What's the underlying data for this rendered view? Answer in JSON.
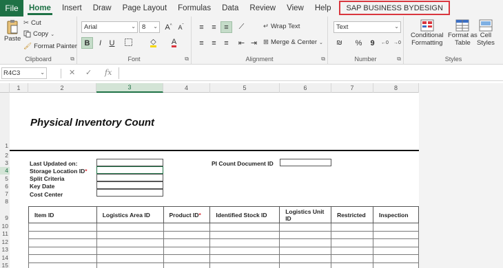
{
  "menu": {
    "file": "File",
    "tabs": [
      "Home",
      "Insert",
      "Draw",
      "Page Layout",
      "Formulas",
      "Data",
      "Review",
      "View",
      "Help"
    ],
    "active_tab": "Home",
    "sap_tab": "SAP BUSINESS BYDESIGN"
  },
  "ribbon": {
    "clipboard": {
      "paste": "Paste",
      "cut": "Cut",
      "copy": "Copy",
      "format_painter": "Format Painter",
      "label": "Clipboard"
    },
    "font": {
      "name": "Arial",
      "size": "8",
      "label": "Font",
      "bold": "B",
      "italic": "I",
      "underline": "U",
      "grow": "A^",
      "shrink": "Aˇ"
    },
    "alignment": {
      "wrap_text": "Wrap Text",
      "merge_center": "Merge & Center",
      "label": "Alignment"
    },
    "number": {
      "format": "Text",
      "label": "Number",
      "percent": "%",
      "comma": "9"
    },
    "styles": {
      "conditional": "Conditional",
      "formatting": "Formatting",
      "format_as": "Format as",
      "table": "Table",
      "cell": "Cell",
      "cell_styles": "Styles",
      "label": "Styles"
    },
    "accent_color": "#1e7145"
  },
  "formula_bar": {
    "name_box": "R4C3",
    "fx": "fx",
    "content": ""
  },
  "columns": [
    "1",
    "2",
    "3",
    "4",
    "5",
    "6",
    "7",
    "8"
  ],
  "selected_column": "3",
  "rows": [
    "1",
    "2",
    "3",
    "4",
    "5",
    "6",
    "7",
    "8",
    "9",
    "10",
    "11",
    "12",
    "13",
    "14",
    "15"
  ],
  "selected_row": "4",
  "sheet": {
    "title": "Physical Inventory Count",
    "fields": {
      "last_updated": "Last Updated on:",
      "storage_location": "Storage Location ID",
      "split_criteria": "Split Criteria",
      "key_date": "Key Date",
      "cost_center": "Cost Center",
      "pi_count_document": "PI Count Document ID",
      "required_mark": "*"
    },
    "table_headers": [
      "Item ID",
      "Logistics Area ID",
      "Product ID",
      "Identified Stock ID",
      "Logistics Unit ID",
      "Restricted",
      "Inspection"
    ],
    "required_marker_color": "#d9363e"
  }
}
